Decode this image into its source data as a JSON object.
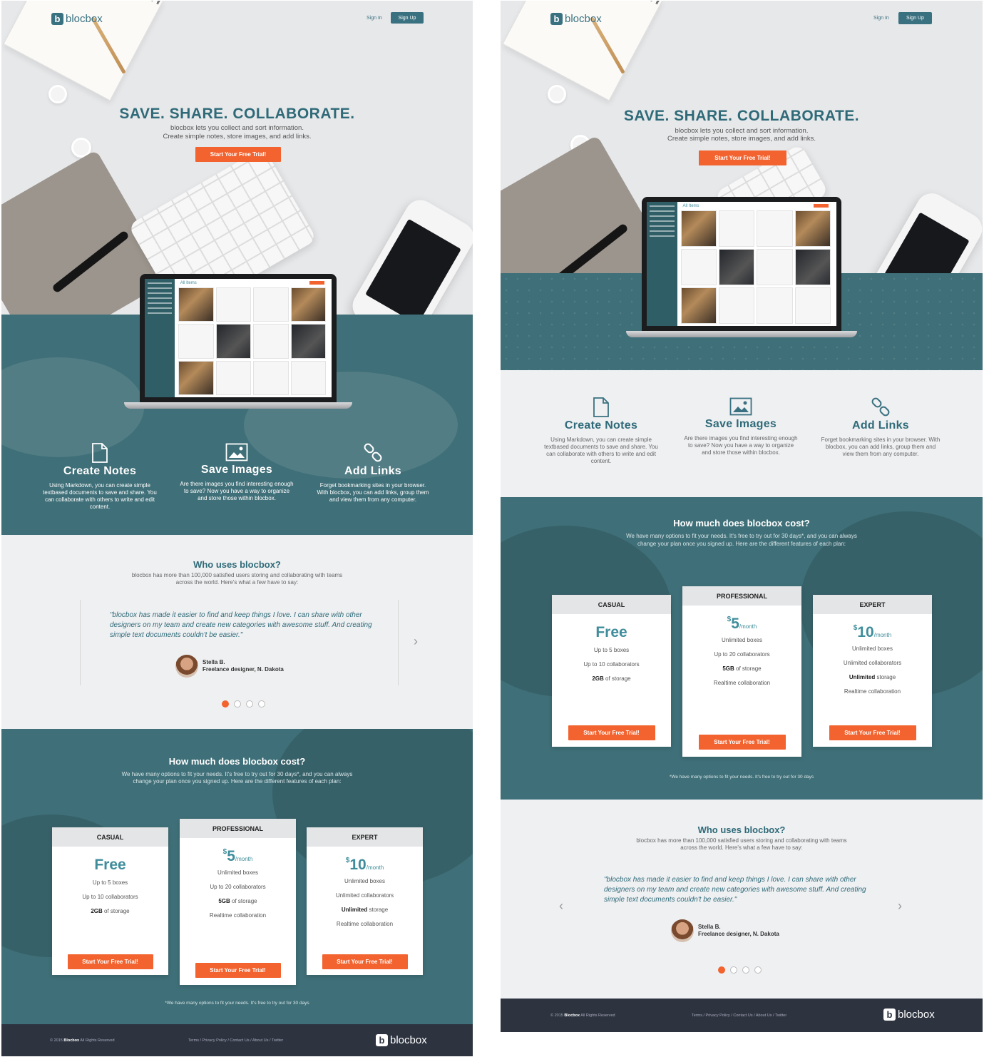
{
  "brand": {
    "name": "blocbox"
  },
  "nav": {
    "sign_in": "Sign In",
    "sign_up": "Sign Up"
  },
  "hero": {
    "headline": "SAVE. SHARE. COLLABORATE.",
    "sub1": "blocbox lets you collect and sort information.",
    "sub2": "Create simple notes, store images, and add links.",
    "cta": "Start Your Free Trial!",
    "app_title": "All Items"
  },
  "features": [
    {
      "icon": "document-icon",
      "title": "Create Notes",
      "text": "Using Markdown, you can create simple textbased documents to save and share. You can collaborate with others to write and edit content."
    },
    {
      "icon": "image-icon",
      "title": "Save Images",
      "text": "Are there images you find interesting enough to save? Now you have a way to organize and store those within blocbox."
    },
    {
      "icon": "link-icon",
      "title": "Add Links",
      "text": "Forget bookmarking sites in your browser. With blocbox, you can add links, group them and view them from any computer."
    }
  ],
  "testimonials": {
    "title": "Who uses blocbox?",
    "sub1": "blocbox has more than 100,000 satisfied users storing and collaborating with teams",
    "sub2": "across the world. Here's what a few have to say:",
    "quote": "\"blocbox has made it easier to find and keep things I love. I can share with other designers on my team and create new categories with awesome stuff. And creating simple text documents couldn't be easier.\"",
    "name": "Stella B.",
    "role": "Freelance designer, N. Dakota"
  },
  "pricing": {
    "title": "How much does blocbox cost?",
    "sub1": "We have many options to fit your needs. It's free to try out for 30 days*, and you can always",
    "sub2": "change your plan once you signed up. Here are the different features of each plan:",
    "note": "*We have many options to fit your needs. It's free to try out for 30 days",
    "plans": [
      {
        "name": "CASUAL",
        "currency": "",
        "price": "Free",
        "period": "",
        "f1": "Up to 5 boxes",
        "f2": "Up to 10 collaborators",
        "f3b": "2GB",
        "f3": " of storage",
        "f4": "",
        "cta": "Start Your Free Trial!"
      },
      {
        "name": "PROFESSIONAL",
        "currency": "$",
        "price": "5",
        "period": "/month",
        "f1": "Unlimited boxes",
        "f2": "Up to 20 collaborators",
        "f3b": "5GB",
        "f3": " of storage",
        "f4": "Realtime collaboration",
        "cta": "Start Your Free Trial!"
      },
      {
        "name": "EXPERT",
        "currency": "$",
        "price": "10",
        "period": "/month",
        "f1": "Unlimited boxes",
        "f2": "Unlimited collaborators",
        "f3b": "Unlimited",
        "f3": " storage",
        "f4": "Realtime collaboration",
        "cta": "Start Your Free Trial!"
      }
    ]
  },
  "footer": {
    "copyright_pre": "© 2015",
    "copyright_brand": "Blocbox",
    "copyright_post": "All Rights Reserved",
    "links": "Terms / Privacy Policy / Contact Us / About Us / Twitter"
  },
  "colors": {
    "teal": "#3f6f78",
    "accent": "#f2632f",
    "heading": "#2f6a78",
    "footer": "#2d3440"
  }
}
